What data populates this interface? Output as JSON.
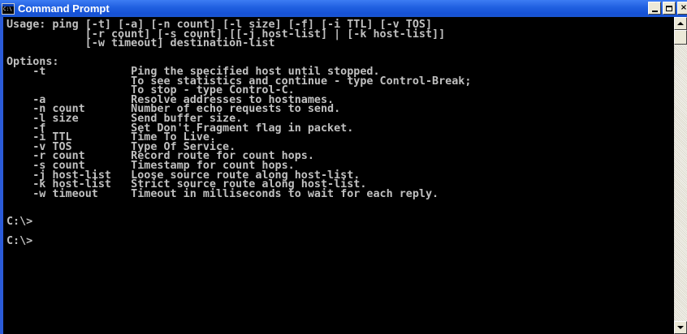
{
  "window": {
    "title": "Command Prompt",
    "icon": "cmd-icon",
    "controls": {
      "minimize_icon": "minimize-icon",
      "maximize_icon": "maximize-icon",
      "close_label": "×"
    }
  },
  "console": {
    "lines": [
      "Usage: ping [-t] [-a] [-n count] [-l size] [-f] [-i TTL] [-v TOS]",
      "            [-r count] [-s count] [[-j host-list] | [-k host-list]]",
      "            [-w timeout] destination-list",
      "",
      "Options:",
      "    -t             Ping the specified host until stopped.",
      "                   To see statistics and continue - type Control-Break;",
      "                   To stop - type Control-C.",
      "    -a             Resolve addresses to hostnames.",
      "    -n count       Number of echo requests to send.",
      "    -l size        Send buffer size.",
      "    -f             Set Don't Fragment flag in packet.",
      "    -i TTL         Time To Live.",
      "    -v TOS         Type Of Service.",
      "    -r count       Record route for count hops.",
      "    -s count       Timestamp for count hops.",
      "    -j host-list   Loose source route along host-list.",
      "    -k host-list   Strict source route along host-list.",
      "    -w timeout     Timeout in milliseconds to wait for each reply.",
      "",
      "",
      "C:\\>",
      "",
      "C:\\>"
    ]
  },
  "colors": {
    "console_bg": "#000000",
    "console_fg": "#c0c0c0",
    "titlebar": "#1f5fe0"
  }
}
